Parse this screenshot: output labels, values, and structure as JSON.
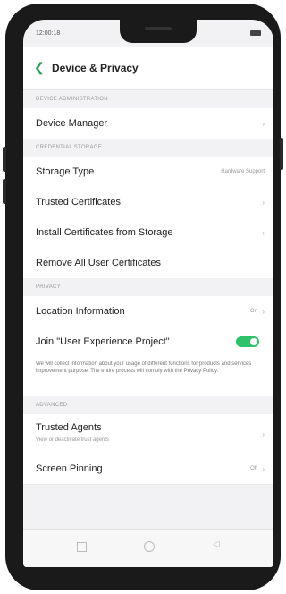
{
  "status_bar": {
    "time": "12:00:18"
  },
  "header": {
    "back_icon": "chevron-left-icon",
    "title": "Device & Privacy"
  },
  "sections": {
    "device_admin": {
      "label": "DEVICE ADMINISTRATION"
    },
    "credential_storage": {
      "label": "CREDENTIAL STORAGE"
    },
    "privacy": {
      "label": "PRIVACY"
    },
    "advanced": {
      "label": "ADVANCED"
    }
  },
  "rows": {
    "device_manager": {
      "label": "Device Manager"
    },
    "storage_type": {
      "label": "Storage Type",
      "value": "Hardware Support"
    },
    "trusted_certificates": {
      "label": "Trusted Certificates"
    },
    "install_certificates": {
      "label": "Install Certificates from Storage"
    },
    "remove_certificates": {
      "label": "Remove All User Certificates"
    },
    "location_information": {
      "label": "Location Information",
      "value": "On"
    },
    "join_experience": {
      "label": "Join \"User Experience Project\"",
      "toggle_on": true
    },
    "trusted_agents": {
      "label": "Trusted Agents",
      "sublabel": "View or deactivate trust agents"
    },
    "screen_pinning": {
      "label": "Screen Pinning",
      "value": "Off"
    }
  },
  "privacy_description": "We will collect information about your usage of different functions for products and services improvement purpose. The entire process will comply with the Privacy Policy.",
  "colors": {
    "accent": "#2e9e5b",
    "toggle": "#2fc26b"
  }
}
